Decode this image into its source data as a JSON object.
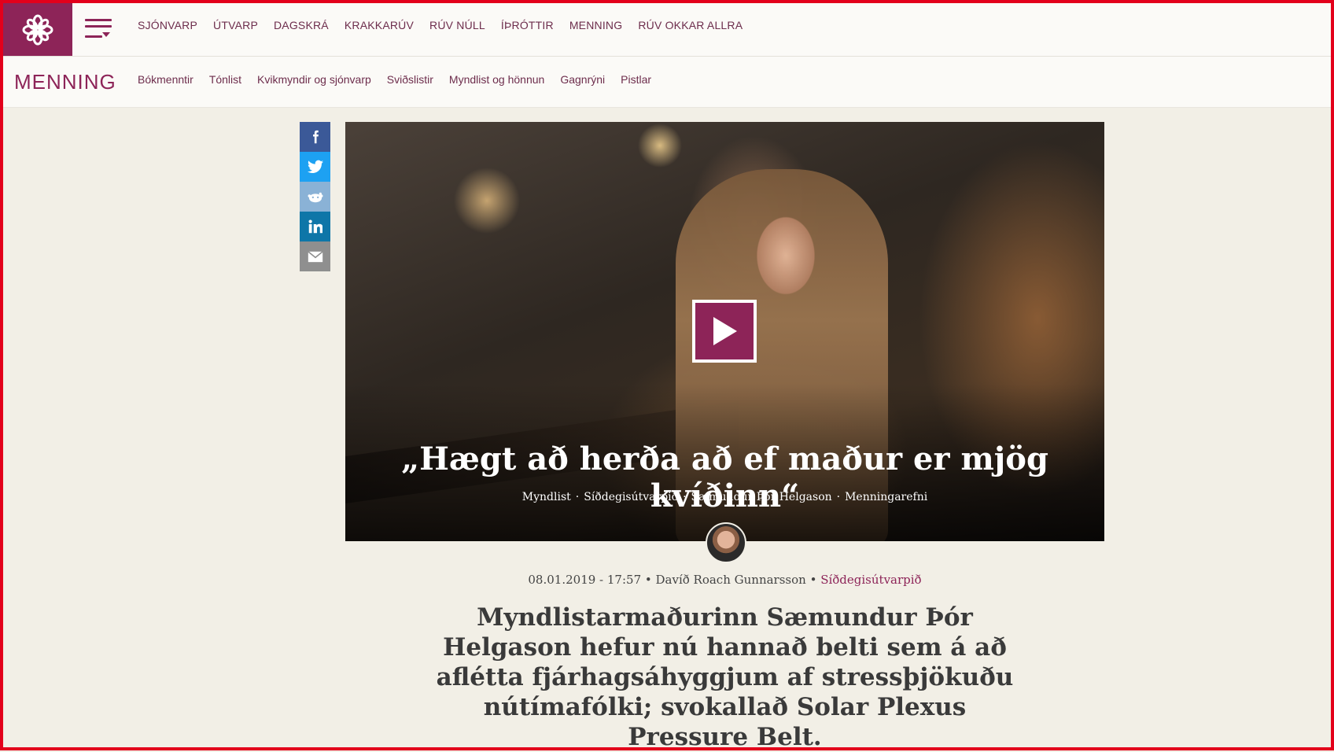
{
  "header": {
    "nav": [
      "SJÓNVARP",
      "ÚTVARP",
      "DAGSKRÁ",
      "KRAKKARÚV",
      "RÚV NÚLL",
      "ÍÞRÓTTIR",
      "MENNING",
      "RÚV OKKAR ALLRA"
    ]
  },
  "section": {
    "title": "MENNING",
    "subnav": [
      "Bókmenntir",
      "Tónlist",
      "Kvikmyndir og sjónvarp",
      "Sviðslistir",
      "Myndlist og hönnun",
      "Gagnrýni",
      "Pistlar"
    ]
  },
  "share": [
    "facebook-icon",
    "twitter-icon",
    "reddit-icon",
    "linkedin-icon",
    "email-icon"
  ],
  "article": {
    "title": "„Hægt að herða að ef maður er mjög kvíðinn“",
    "tags": [
      "Myndlist",
      "Síðdegisútvarpið",
      "Sæmundur Þór Helgason",
      "Menningarefni"
    ],
    "date": "08.01.2019 - 17:57",
    "author": "Davíð Roach Gunnarsson",
    "program": "Síðdegisútvarpið",
    "lead": "Myndlistarmaðurinn Sæmundur Þór Helgason hefur nú hannað belti sem á að aflétta fjárhagsáhyggjum af stressþjökuðu nútímafólki; svokallað Solar Plexus Pressure Belt."
  },
  "colors": {
    "brand": "#8d2458",
    "background": "#f2efe6"
  }
}
